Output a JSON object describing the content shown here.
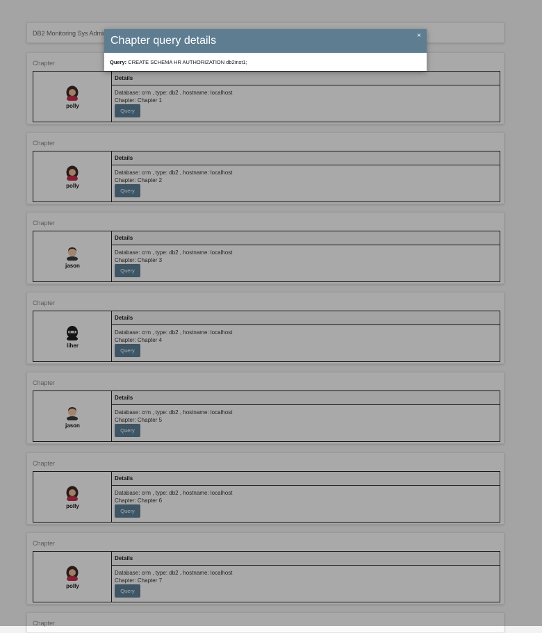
{
  "header": {
    "title": "DB2 Monitoring Sys Admins"
  },
  "chapters": [
    {
      "label": "Chapter",
      "user": "polly",
      "avatar": "female-avatar-icon",
      "details_header": "Details",
      "database_line": "Database: crm , type: db2 , hostname: localhost",
      "chapter_line": "Chapter: Chapter 1",
      "button": "Query"
    },
    {
      "label": "Chapter",
      "user": "polly",
      "avatar": "female-avatar-icon",
      "details_header": "Details",
      "database_line": "Database: crm , type: db2 , hostname: localhost",
      "chapter_line": "Chapter: Chapter 2",
      "button": "Query"
    },
    {
      "label": "Chapter",
      "user": "jason",
      "avatar": "male-avatar-icon",
      "details_header": "Details",
      "database_line": "Database: crm , type: db2 , hostname: localhost",
      "chapter_line": "Chapter: Chapter 3",
      "button": "Query"
    },
    {
      "label": "Chapter",
      "user": "liher",
      "avatar": "masked-avatar-icon",
      "details_header": "Details",
      "database_line": "Database: crm , type: db2 , hostname: localhost",
      "chapter_line": "Chapter: Chapter 4",
      "button": "Query"
    },
    {
      "label": "Chapter",
      "user": "jason",
      "avatar": "male-avatar-icon",
      "details_header": "Details",
      "database_line": "Database: crm , type: db2 , hostname: localhost",
      "chapter_line": "Chapter: Chapter 5",
      "button": "Query"
    },
    {
      "label": "Chapter",
      "user": "polly",
      "avatar": "female-avatar-icon",
      "details_header": "Details",
      "database_line": "Database: crm , type: db2 , hostname: localhost",
      "chapter_line": "Chapter: Chapter 6",
      "button": "Query"
    },
    {
      "label": "Chapter",
      "user": "polly",
      "avatar": "female-avatar-icon",
      "details_header": "Details",
      "database_line": "Database: crm , type: db2 , hostname: localhost",
      "chapter_line": "Chapter: Chapter 7",
      "button": "Query"
    },
    {
      "label": "Chapter"
    }
  ],
  "modal": {
    "title": "Chapter query details",
    "close": "×",
    "query_label": "Query:",
    "query_text": "CREATE SCHEMA HR AUTHORIZATION db2inst1;"
  },
  "colors": {
    "modal_header": "#5e7d91",
    "button": "#5c7e96",
    "overlay": "rgba(0,0,0,0.32)"
  }
}
